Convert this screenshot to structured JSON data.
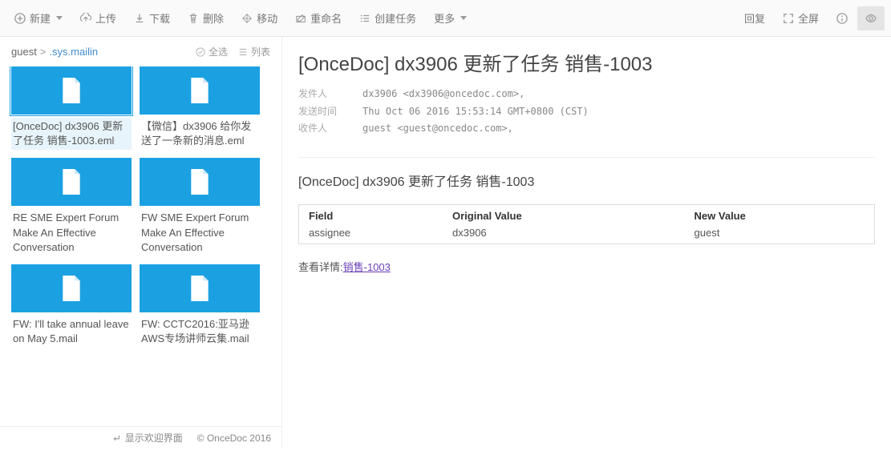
{
  "toolbar": {
    "new_label": "新建",
    "upload_label": "上传",
    "download_label": "下载",
    "delete_label": "删除",
    "move_label": "移动",
    "rename_label": "重命名",
    "create_task_label": "创建任务",
    "more_label": "更多",
    "reply_label": "回复",
    "fullscreen_label": "全屏"
  },
  "breadcrumb": {
    "root": "guest",
    "current": ".sys.mailin"
  },
  "path_actions": {
    "select_all": "全选",
    "list_view": "列表"
  },
  "files": [
    {
      "name": "[OnceDoc] dx3906 更新了任务 销售-1003.eml"
    },
    {
      "name": "【微信】dx3906 给你发送了一条新的消息.eml"
    },
    {
      "name": "RE SME Expert Forum Make An Effective Conversation"
    },
    {
      "name": "FW SME Expert Forum Make An Effective Conversation"
    },
    {
      "name": "FW: I'll take annual leave on May 5.mail"
    },
    {
      "name": "FW: CCTC2016:亚马逊AWS专场讲师云集.mail"
    }
  ],
  "mail": {
    "title": "[OnceDoc] dx3906 更新了任务 销售-1003",
    "from_label": "发件人",
    "from_value": "dx3906 <dx3906@oncedoc.com>,",
    "date_label": "发送时间",
    "date_value": "Thu Oct 06 2016 15:53:14 GMT+0800 (CST)",
    "to_label": "收件人",
    "to_value": "guest <guest@oncedoc.com>,",
    "body_subject": "[OnceDoc] dx3906 更新了任务 销售-1003",
    "table": {
      "h_field": "Field",
      "h_orig": "Original Value",
      "h_new": "New Value",
      "r_field": "assignee",
      "r_orig": "dx3906",
      "r_new": "guest"
    },
    "detail_prefix": "查看详情:",
    "detail_link": "销售-1003"
  },
  "footer": {
    "welcome_label": "显示欢迎界面",
    "copyright": "© OnceDoc 2016"
  }
}
